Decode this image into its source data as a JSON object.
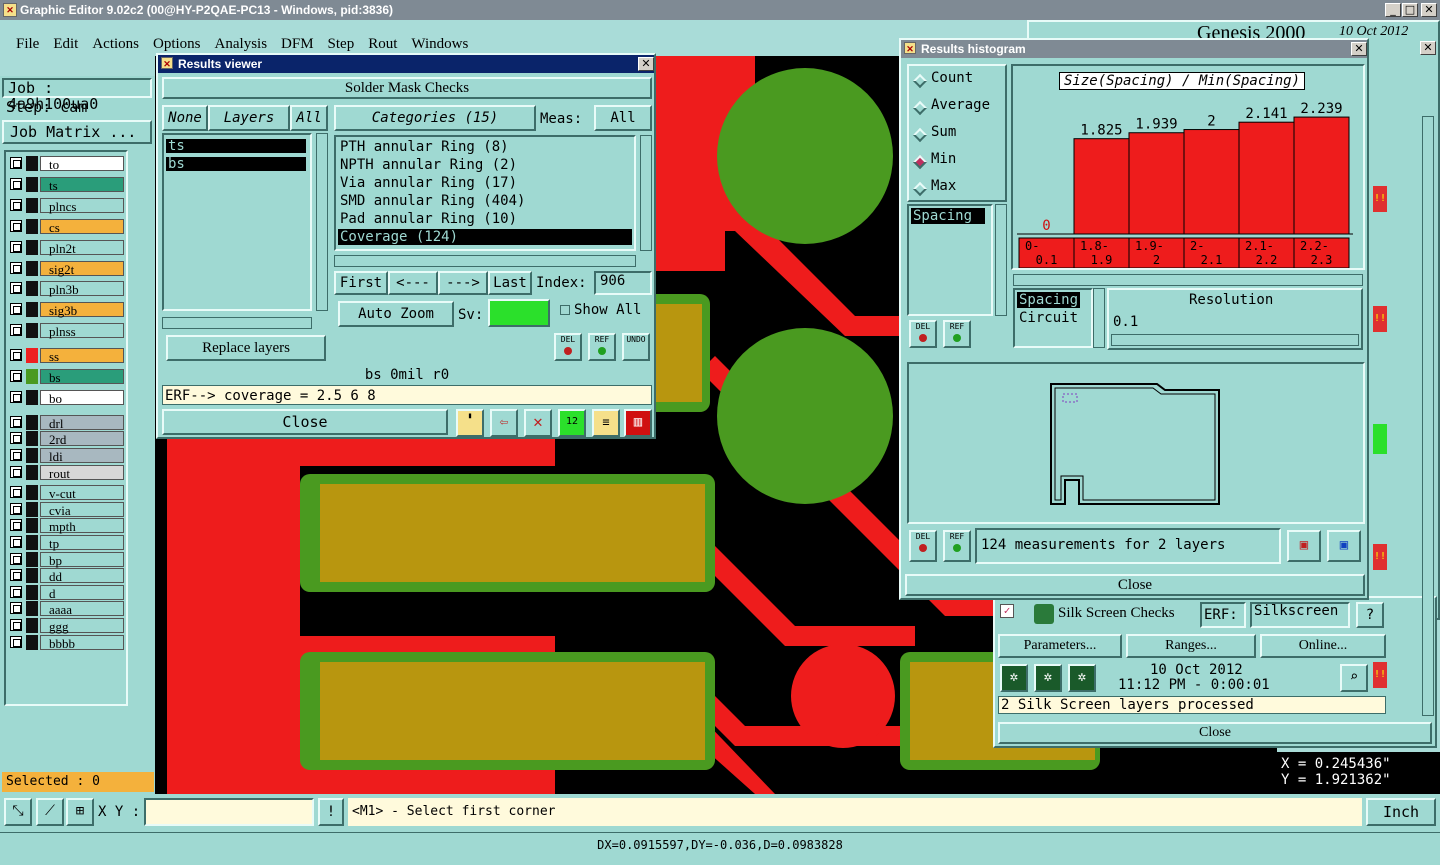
{
  "app": {
    "title": "Graphic Editor 9.02c2 (00@HY-P2QAE-PC13 - Windows, pid:3836)",
    "genesis": "Genesis 2000",
    "date_top": "10 Oct 2012"
  },
  "menu": [
    "File",
    "Edit",
    "Actions",
    "Options",
    "Analysis",
    "DFM",
    "Step",
    "Rout",
    "Windows"
  ],
  "left": {
    "job_label": "Job : 4a9h100ua0",
    "step_label": "Step: cam",
    "job_matrix": "Job Matrix ...",
    "selected": "Selected : 0",
    "layers": [
      {
        "name": "to",
        "bg": "#ffffff",
        "sw": "#111111"
      },
      {
        "name": "ts",
        "bg": "#2a9d7a",
        "sw": "#111111"
      },
      {
        "name": "plncs",
        "bg": "#9fd9d2",
        "sw": "#111111"
      },
      {
        "name": "cs",
        "bg": "#f4b13c",
        "sw": "#111111"
      },
      {
        "name": "pln2t",
        "bg": "#9fd9d2",
        "sw": "#111111"
      },
      {
        "name": "sig2t",
        "bg": "#f4b13c",
        "sw": "#111111"
      },
      {
        "name": "pln3b",
        "bg": "#9fd9d2",
        "sw": "#111111"
      },
      {
        "name": "sig3b",
        "bg": "#f4b13c",
        "sw": "#111111"
      },
      {
        "name": "plnss",
        "bg": "#9fd9d2",
        "sw": "#111111"
      },
      {
        "name": "ss",
        "bg": "#f4b13c",
        "sw": "#ee2020"
      },
      {
        "name": "bs",
        "bg": "#2a9d7a",
        "sw": "#4a9a20"
      },
      {
        "name": "bo",
        "bg": "#ffffff",
        "sw": "#111111"
      },
      {
        "name": "drl",
        "bg": "#a8b8c0",
        "sw": "#111111"
      },
      {
        "name": "2rd",
        "bg": "#a8b8c0",
        "sw": "#111111"
      },
      {
        "name": "ldi",
        "bg": "#a8b8c0",
        "sw": "#111111"
      },
      {
        "name": "rout",
        "bg": "#d8d8d8",
        "sw": "#111111"
      },
      {
        "name": "v-cut",
        "bg": "#9fd9d2",
        "sw": "#111111"
      },
      {
        "name": "cvia",
        "bg": "#9fd9d2",
        "sw": "#111111"
      },
      {
        "name": "mpth",
        "bg": "#9fd9d2",
        "sw": "#111111"
      },
      {
        "name": "tp",
        "bg": "#9fd9d2",
        "sw": "#111111"
      },
      {
        "name": "bp",
        "bg": "#9fd9d2",
        "sw": "#111111"
      },
      {
        "name": "dd",
        "bg": "#9fd9d2",
        "sw": "#111111"
      },
      {
        "name": "d",
        "bg": "#9fd9d2",
        "sw": "#111111"
      },
      {
        "name": "aaaa",
        "bg": "#9fd9d2",
        "sw": "#111111"
      },
      {
        "name": "ggg",
        "bg": "#9fd9d2",
        "sw": "#111111"
      },
      {
        "name": "bbbb",
        "bg": "#9fd9d2",
        "sw": "#111111"
      }
    ]
  },
  "results_viewer": {
    "title": "Results viewer",
    "header": "Solder Mask Checks",
    "none": "None",
    "layers": "Layers",
    "all": "All",
    "layer_list": [
      "ts",
      "bs"
    ],
    "categories": "Categories (15)",
    "meas_label": "Meas:",
    "meas_value": "All",
    "cat_list": [
      "PTH annular Ring (8)",
      "NPTH annular Ring (2)",
      "Via annular Ring (17)",
      "SMD annular Ring (404)",
      "Pad annular Ring (10)",
      "Coverage (124)"
    ],
    "first": "First",
    "prev": "<---",
    "next": "--->",
    "last": "Last",
    "index_label": "Index:",
    "index_value": "906",
    "auto_zoom": "Auto Zoom",
    "sv_label": "Sv:",
    "show_all": "Show All",
    "replace_layers": "Replace layers",
    "del": "DEL",
    "ref": "REF",
    "undo": "UNDO",
    "status": "bs 0mil  r0",
    "erf": "ERF--> coverage = 2.5 6 8",
    "close": "Close"
  },
  "histogram": {
    "title": "Results histogram",
    "radios": [
      "Count",
      "Average",
      "Sum",
      "Min",
      "Max"
    ],
    "selected_radio": "Min",
    "list": [
      "Spacing"
    ],
    "chart_title": "Size(Spacing) / Min(Spacing)",
    "chart_data": {
      "type": "bar",
      "title": "Size(Spacing) / Min(Spacing)",
      "categories": [
        "0-\n0.1",
        "1.8-\n1.9",
        "1.9-\n2",
        "2-\n2.1",
        "2.1-\n2.2",
        "2.2-\n2.3"
      ],
      "values": [
        0,
        1.825,
        1.939,
        2,
        2.141,
        2.239
      ],
      "labels": [
        "0",
        "1.825",
        "1.939",
        "2",
        "2.141",
        "2.239"
      ],
      "ylim": [
        0,
        2.5
      ]
    },
    "cat_labels": [
      [
        "0-",
        "0.1"
      ],
      [
        "1.8-",
        "1.9"
      ],
      [
        "1.9-",
        "2"
      ],
      [
        "2-",
        "2.1"
      ],
      [
        "2.1-",
        "2.2"
      ],
      [
        "2.2-",
        "2.3"
      ]
    ],
    "spacing": "Spacing",
    "circuit": "Circuit",
    "resolution": "Resolution",
    "res_value": "0.1",
    "measurements": "124 measurements for 2 layers",
    "close": "Close",
    "del": "DEL",
    "ref": "REF"
  },
  "silk": {
    "label": "Silk Screen Checks",
    "erf": "ERF:",
    "erf_value": "Silkscreen",
    "q": "?",
    "parameters": "Parameters...",
    "ranges": "Ranges...",
    "online": "Online...",
    "date": "10 Oct 2012",
    "time": "11:12 PM - 0:00:01",
    "processed": "2 Silk Screen layers processed",
    "close": "Close"
  },
  "coords": {
    "x": "X = 0.245436\"",
    "y": "Y = 1.921362\""
  },
  "bottom": {
    "xy_label": "X Y :",
    "prompt": "<M1> - Select first corner",
    "unit": "Inch",
    "status": "DX=0.0915597,DY=-0.036,D=0.0983828",
    "excl": "!"
  }
}
